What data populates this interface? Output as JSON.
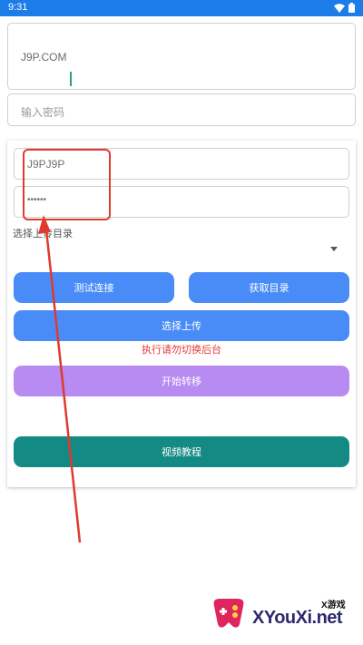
{
  "status_bar": {
    "time": "9:31",
    "background": "#1c7de8",
    "icons": [
      "wifi-icon",
      "battery-icon"
    ]
  },
  "server_field": {
    "value": "J9P.COM"
  },
  "password_field": {
    "placeholder": "输入密码"
  },
  "card": {
    "username_value": "J9PJ9P",
    "password_masked": "••••••",
    "dir_label": "选择上传目录",
    "test_button": "测试连接",
    "fetch_button": "获取目录",
    "upload_button": "选择上传",
    "warning_text": "执行请勿切换后台",
    "start_button": "开始转移",
    "video_button": "视频教程"
  },
  "colors": {
    "blue_button": "#4a8cf7",
    "purple_button": "#b88bf2",
    "teal_button": "#138a84",
    "warning": "#e53935",
    "annotation": "#e03a2f"
  },
  "watermark": {
    "small_text": "X游戏",
    "site_text": "XYouXi.net"
  }
}
